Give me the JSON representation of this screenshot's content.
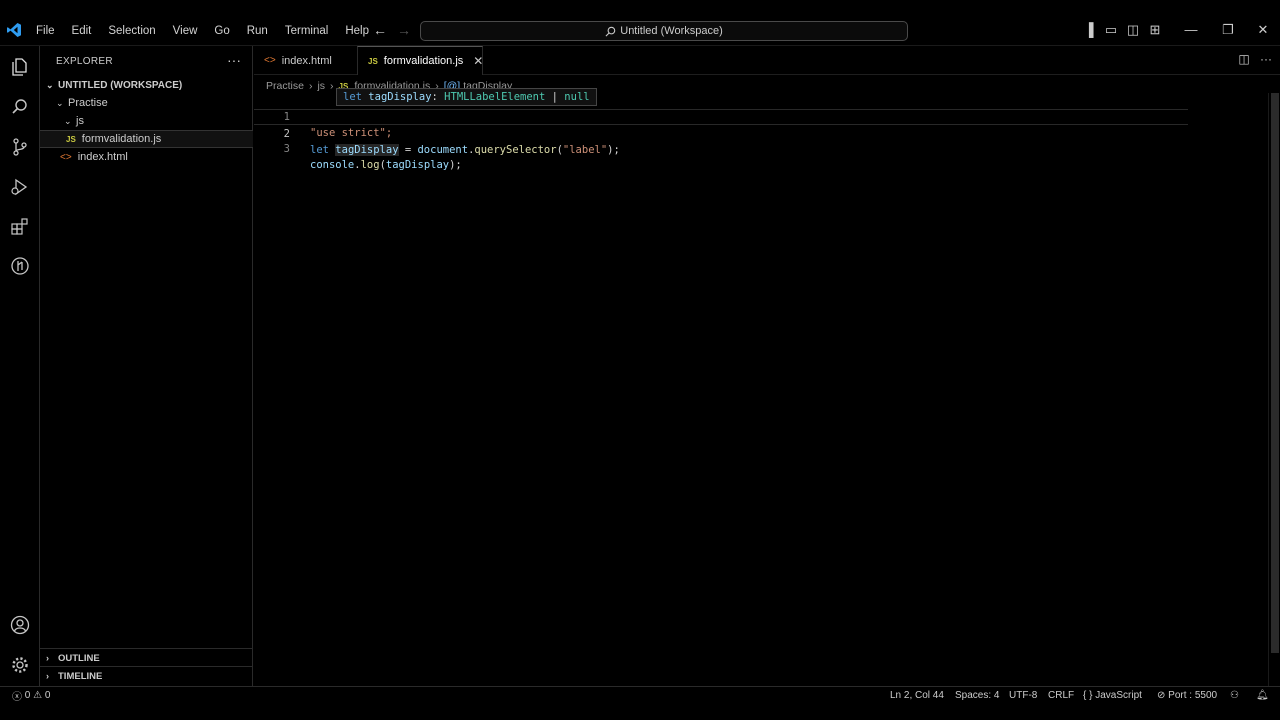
{
  "titlebar": {
    "menu": [
      "File",
      "Edit",
      "Selection",
      "View",
      "Go",
      "Run",
      "Terminal",
      "Help"
    ],
    "search_text": "Untitled (Workspace)"
  },
  "explorer": {
    "title": "EXPLORER",
    "workspace": "UNTITLED (WORKSPACE)",
    "folder": "Practise",
    "subfolder": "js",
    "files": [
      {
        "name": "formvalidation.js",
        "type": "js"
      },
      {
        "name": "index.html",
        "type": "html"
      }
    ],
    "outline": "OUTLINE",
    "timeline": "TIMELINE"
  },
  "tabs": [
    {
      "label": "index.html",
      "active": false
    },
    {
      "label": "formvalidation.js",
      "active": true
    }
  ],
  "breadcrumb": [
    "Practise",
    "js",
    "formvalidation.js",
    "tagDisplay"
  ],
  "editor": {
    "lines": [
      {
        "num": "1",
        "text": "\"use strict\";"
      },
      {
        "num": "2",
        "text": "let tagDisplay = document.querySelector(\"label\");"
      },
      {
        "num": "3",
        "text": "console.log(tagDisplay);"
      }
    ],
    "hover": "let tagDisplay: HTMLLabelElement | null"
  },
  "statusbar": {
    "errors": "0",
    "warnings": "0",
    "position": "Ln 2, Col 44",
    "spaces": "Spaces: 4",
    "encoding": "UTF-8",
    "eol": "CRLF",
    "language": "JavaScript",
    "port": "Port : 5500"
  }
}
